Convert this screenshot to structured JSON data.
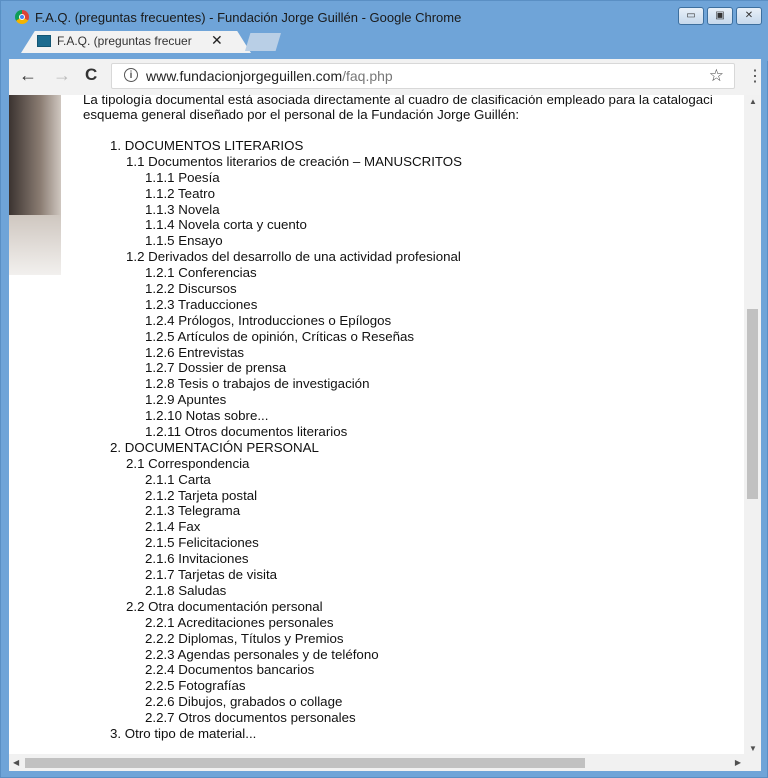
{
  "window": {
    "title": "F.A.Q. (preguntas frecuentes) - Fundación Jorge Guillén - Google Chrome",
    "minimize": "▭",
    "maximize": "▣",
    "close": "✕"
  },
  "tab": {
    "title": "F.A.Q. (preguntas frecuer",
    "close": "✕"
  },
  "toolbar": {
    "back": "←",
    "forward": "→",
    "reload": "C",
    "info": "i",
    "url_host": "www.fundacionjorgeguillen.com",
    "url_path": "/faq.php",
    "star": "☆",
    "menu": "⋮"
  },
  "content": {
    "intro_line1": "La tipología documental está asociada directamente al cuadro de clasificación empleado para la catalogaci",
    "intro_line2": "esquema general diseñado por el personal de la Fundación Jorge Guillén:",
    "items": [
      {
        "level": 1,
        "text": "1. DOCUMENTOS LITERARIOS"
      },
      {
        "level": 2,
        "text": "1.1 Documentos literarios de creación – MANUSCRITOS"
      },
      {
        "level": 3,
        "text": "1.1.1 Poesía"
      },
      {
        "level": 3,
        "text": "1.1.2 Teatro"
      },
      {
        "level": 3,
        "text": "1.1.3 Novela"
      },
      {
        "level": 3,
        "text": "1.1.4 Novela corta y cuento"
      },
      {
        "level": 3,
        "text": "1.1.5 Ensayo"
      },
      {
        "level": 2,
        "text": "1.2 Derivados del desarrollo de una actividad profesional"
      },
      {
        "level": 3,
        "text": "1.2.1 Conferencias"
      },
      {
        "level": 3,
        "text": "1.2.2 Discursos"
      },
      {
        "level": 3,
        "text": "1.2.3 Traducciones"
      },
      {
        "level": 3,
        "text": "1.2.4 Prólogos, Introducciones o Epílogos"
      },
      {
        "level": 3,
        "text": "1.2.5 Artículos de opinión, Críticas o Reseñas"
      },
      {
        "level": 3,
        "text": "1.2.6 Entrevistas"
      },
      {
        "level": 3,
        "text": "1.2.7 Dossier de prensa"
      },
      {
        "level": 3,
        "text": "1.2.8 Tesis o trabajos de investigación"
      },
      {
        "level": 3,
        "text": "1.2.9 Apuntes"
      },
      {
        "level": 3,
        "text": "1.2.10 Notas sobre..."
      },
      {
        "level": 3,
        "text": "1.2.11 Otros documentos literarios"
      },
      {
        "level": 1,
        "text": "2. DOCUMENTACIÓN PERSONAL"
      },
      {
        "level": 2,
        "text": "2.1 Correspondencia"
      },
      {
        "level": 3,
        "text": "2.1.1 Carta"
      },
      {
        "level": 3,
        "text": "2.1.2 Tarjeta postal"
      },
      {
        "level": 3,
        "text": "2.1.3 Telegrama"
      },
      {
        "level": 3,
        "text": "2.1.4 Fax"
      },
      {
        "level": 3,
        "text": "2.1.5 Felicitaciones"
      },
      {
        "level": 3,
        "text": "2.1.6 Invitaciones"
      },
      {
        "level": 3,
        "text": "2.1.7 Tarjetas de visita"
      },
      {
        "level": 3,
        "text": "2.1.8 Saludas"
      },
      {
        "level": 2,
        "text": "2.2 Otra documentación personal"
      },
      {
        "level": 3,
        "text": "2.2.1 Acreditaciones personales"
      },
      {
        "level": 3,
        "text": "2.2.2 Diplomas, Títulos y Premios"
      },
      {
        "level": 3,
        "text": "2.2.3 Agendas personales y de teléfono"
      },
      {
        "level": 3,
        "text": "2.2.4 Documentos bancarios"
      },
      {
        "level": 3,
        "text": "2.2.5 Fotografías"
      },
      {
        "level": 3,
        "text": "2.2.6 Dibujos, grabados o collage"
      },
      {
        "level": 3,
        "text": "2.2.7 Otros documentos personales"
      },
      {
        "level": 1,
        "text": "3. Otro tipo de material..."
      }
    ]
  },
  "scrollbars": {
    "up": "▲",
    "down": "▼",
    "left": "◀",
    "right": "▶"
  }
}
